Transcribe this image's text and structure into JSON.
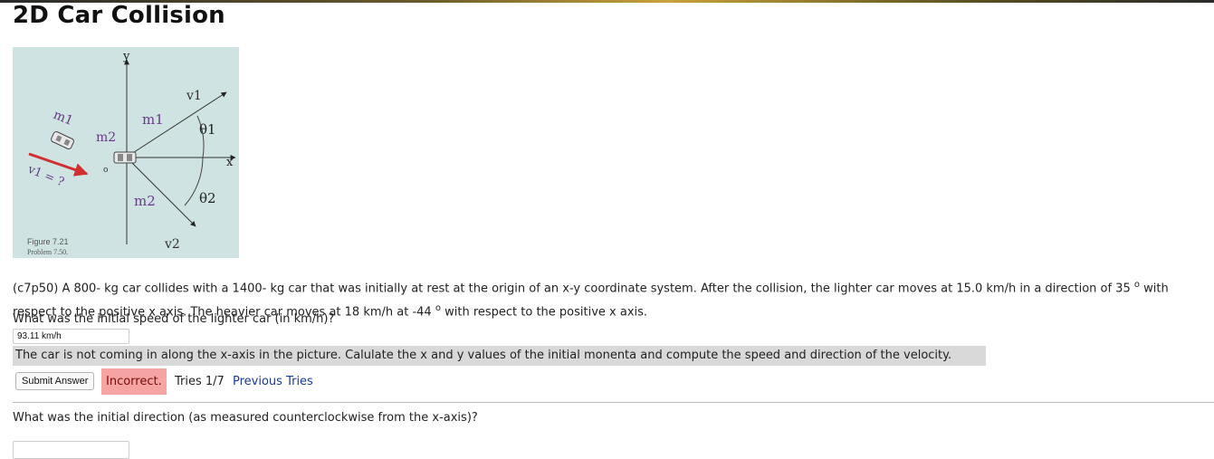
{
  "page": {
    "title": "2D Car Collision"
  },
  "figure": {
    "caption_line1": "Figure 7.21",
    "caption_line2": "Problem 7.50.",
    "labels": {
      "y_axis": "y",
      "x_axis": "x",
      "v1": "v1",
      "v2": "v2",
      "m1_top": "m1",
      "m2_bottom": "m2",
      "m2_origin": "m2",
      "theta1": "θ1",
      "theta2": "θ2",
      "origin": "o",
      "m1_incoming": "m1",
      "v1_incoming": "v1 = ?"
    }
  },
  "problem": {
    "text_before_deg1": "(c7p50) A 800- kg car collides with a 1400- kg car that was initially at rest at the origin of an x-y coordinate system. After the collision, the lighter car moves at 15.0 km/h in a direction of 35 ",
    "deg_symbol": "o",
    "text_between": " with respect to the positive x axis. The heavier car moves at 18 km/h at -44 ",
    "text_after_deg2": " with respect to the positive x axis."
  },
  "question1": {
    "text": "What was the initial speed of the lighter car (in km/h)?",
    "answer_value": "93.11 km/h",
    "hint": "The car is not coming in along the x-axis in the picture. Calulate the x and y values of the initial monenta and compute the speed and direction of the velocity.",
    "submit_label": "Submit Answer",
    "status": "Incorrect.",
    "tries": "Tries 1/7",
    "previous_tries_label": "Previous Tries"
  },
  "question2": {
    "text": "What was the initial direction (as measured counterclockwise from the x-axis)?",
    "answer_value": ""
  },
  "colors": {
    "incorrect_bg": "#f5a3a3",
    "hint_bg": "#d9d9d9",
    "link": "#1a3aa0",
    "figure_bg": "#cfe3e3",
    "arrow_red": "#d03030",
    "label_purple": "#6a3a8a"
  }
}
